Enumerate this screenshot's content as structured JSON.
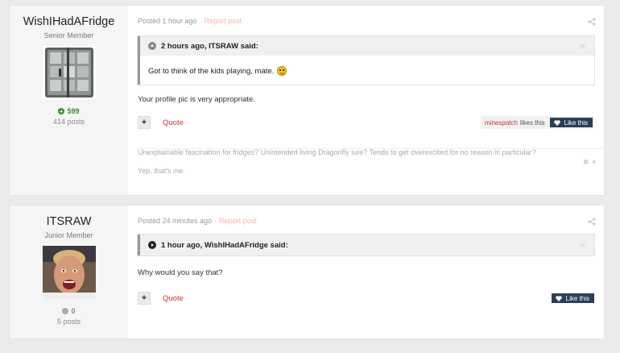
{
  "posts": [
    {
      "author": {
        "name": "WishIHadAFridge",
        "role": "Senior Member",
        "reputation": "599",
        "posts": "414 posts"
      },
      "meta": {
        "posted": "Posted 1 hour ago",
        "report": "Report post"
      },
      "quote": {
        "header": "2 hours ago, ITSRAW said:",
        "text": "Got to think of the kids playing, mate."
      },
      "body": "Your profile pic is very appropriate.",
      "actions": {
        "plus": "+",
        "quote": "Quote",
        "liker": "minespatch",
        "likes_text": "likes this",
        "like_button": "Like this"
      },
      "signature": {
        "line1": "Unexplainable fascination for fridges? Unintended living Dragonfly lure? Tends to get overexcited for no reason in particular?",
        "line2": "Yep, that's me."
      }
    },
    {
      "author": {
        "name": "ITSRAW",
        "role": "Junior Member",
        "reputation": "0",
        "posts": "5 posts"
      },
      "meta": {
        "posted": "Posted 24 minutes ago",
        "report": "Report post"
      },
      "quote": {
        "header": "1 hour ago, WishIHadAFridge said:"
      },
      "body": "Why would you say that?",
      "actions": {
        "plus": "+",
        "quote": "Quote",
        "like_button": "Like this"
      }
    }
  ],
  "icons": {
    "share": "share-icon",
    "reputation_positive": "plus-circle-icon",
    "reputation_neutral": "circle-icon",
    "heart": "heart-icon",
    "emoji": "grin-emoji-icon"
  },
  "colors": {
    "accent_link": "#c0392b",
    "like_button": "#2c3e56",
    "reputation_positive": "#3c8a2e"
  }
}
